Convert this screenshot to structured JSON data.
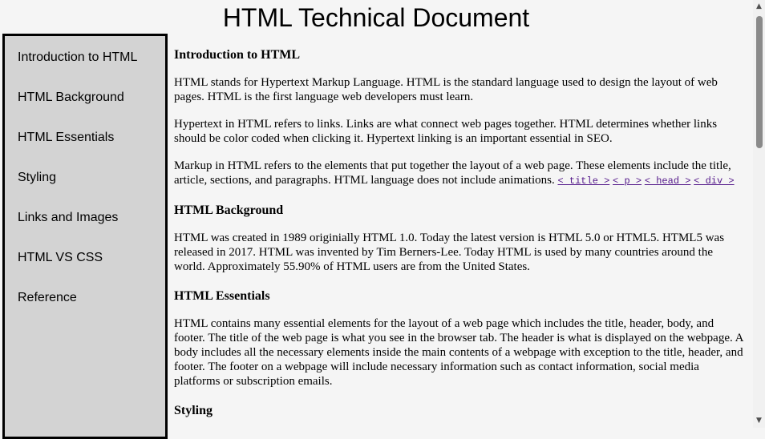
{
  "header": {
    "title": "HTML Technical Document"
  },
  "nav": {
    "items": [
      "Introduction to HTML",
      "HTML Background",
      "HTML Essentials",
      "Styling",
      "Links and Images",
      "HTML VS CSS",
      "Reference"
    ]
  },
  "sections": {
    "intro": {
      "title": "Introduction to HTML",
      "p1": "HTML stands for Hypertext Markup Language. HTML is the standard language used to design the layout of web pages. HTML is the first language web developers must learn.",
      "p2": "Hypertext in HTML refers to links. Links are what connect web pages together. HTML determines whether links should be color coded when clicking it. Hypertext linking is an important essential in SEO.",
      "p3": "Markup in HTML refers to the elements that put together the layout of a web page. These elements include the title, article, sections, and paragraphs. HTML language does not include animations.",
      "code_links": [
        "< title >",
        "< p >",
        "< head >",
        "< div >"
      ]
    },
    "background": {
      "title": "HTML Background",
      "p1": "HTML was created in 1989 originially HTML 1.0. Today the latest version is HTML 5.0 or HTML5. HTML5 was released in 2017. HTML was invented by Tim Berners-Lee. Today HTML is used by many countries around the world. Approximately 55.90% of HTML users are from the United States."
    },
    "essentials": {
      "title": "HTML Essentials",
      "p1": "HTML contains many essential elements for the layout of a web page which includes the title, header, body, and footer. The title of the web page is what you see in the browser tab. The header is what is displayed on the webpage. A body includes all the necessary elements inside the main contents of a webpage with exception to the title, header, and footer. The footer on a webpage will include necessary information such as contact information, social media platforms or subscription emails."
    },
    "styling": {
      "title": "Styling"
    }
  },
  "scrollbar": {
    "up_icon": "▲",
    "down_icon": "▼"
  }
}
